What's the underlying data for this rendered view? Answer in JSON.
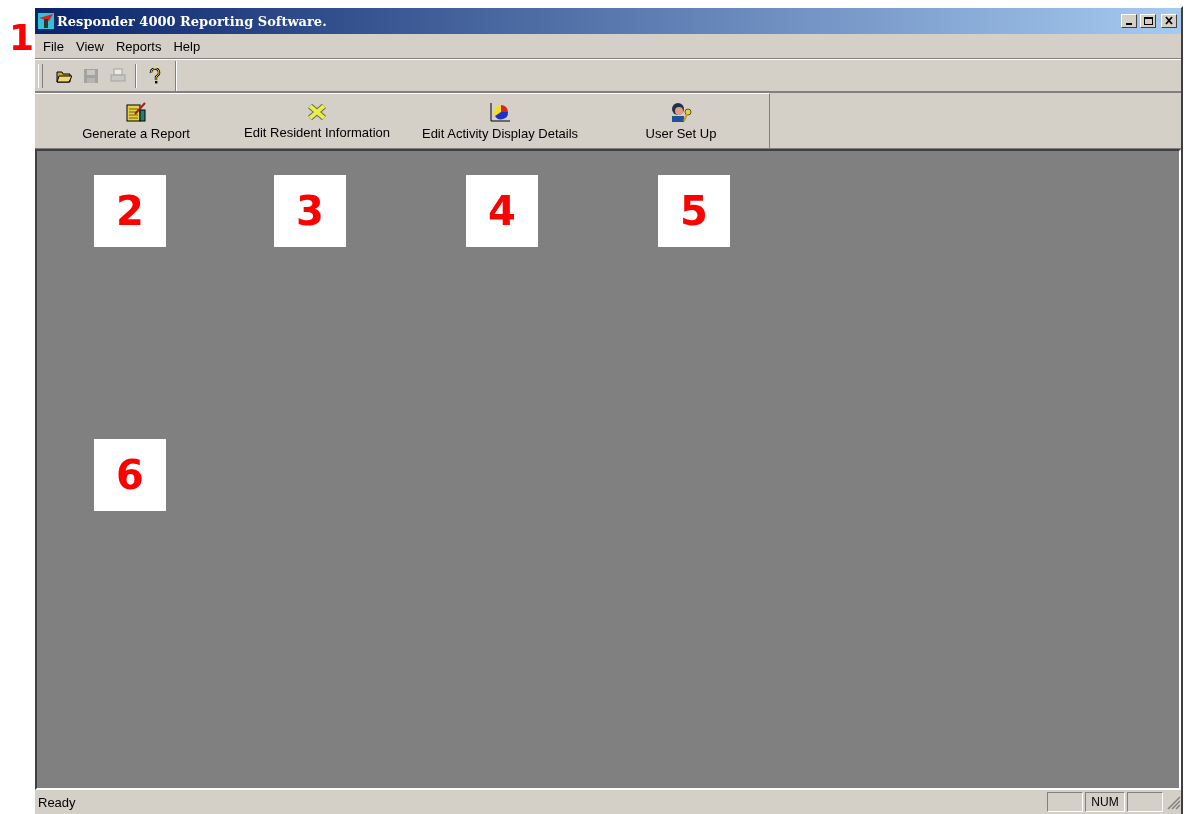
{
  "window": {
    "title": "Responder 4000 Reporting Software."
  },
  "menu": [
    {
      "label": "File"
    },
    {
      "label": "View"
    },
    {
      "label": "Reports"
    },
    {
      "label": "Help"
    }
  ],
  "toolbar": [
    {
      "kind": "open",
      "disabled": false
    },
    {
      "kind": "save",
      "disabled": true
    },
    {
      "kind": "print",
      "disabled": true
    },
    {
      "kind": "separator"
    },
    {
      "kind": "help",
      "disabled": false
    }
  ],
  "launch_bar": [
    {
      "kind": "report",
      "label": "Generate a Report"
    },
    {
      "kind": "resident",
      "label": "Edit Resident Information"
    },
    {
      "kind": "chart",
      "label": "Edit Activity Display Details"
    },
    {
      "kind": "user",
      "label": "User Set Up"
    }
  ],
  "status_bar": {
    "text": "Ready",
    "panels": [
      {
        "kind": "blank"
      },
      {
        "kind": "text",
        "text": "NUM"
      },
      {
        "kind": "blank"
      }
    ]
  },
  "callouts": [
    {
      "label": "1",
      "boxed": false
    },
    {
      "label": "2",
      "boxed": true
    },
    {
      "label": "3",
      "boxed": true
    },
    {
      "label": "4",
      "boxed": true
    },
    {
      "label": "5",
      "boxed": true
    },
    {
      "label": "6",
      "boxed": true
    }
  ]
}
